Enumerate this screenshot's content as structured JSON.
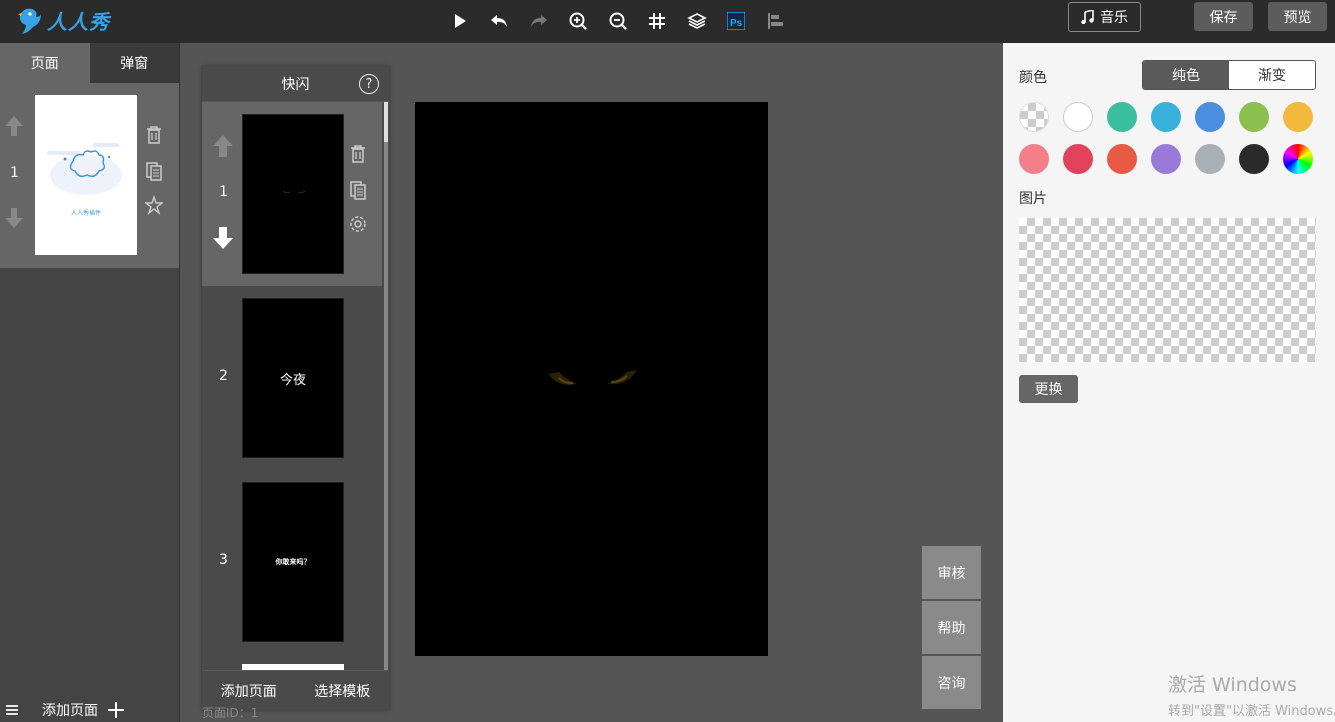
{
  "app": {
    "logo_text": "人人秀"
  },
  "toolbar": {
    "tools": [
      "play-icon",
      "undo-icon",
      "redo-icon",
      "zoom-in-icon",
      "zoom-out-icon",
      "grid-icon",
      "layers-icon",
      "ps-icon",
      "align-icon"
    ],
    "ps_label": "Ps",
    "music_label": "音乐",
    "save_label": "保存",
    "preview_label": "预览"
  },
  "left_panel": {
    "tabs": [
      "页面",
      "弹窗"
    ],
    "page": {
      "number": "1",
      "thumb_caption": "人人秀插件"
    },
    "add_page_label": "添加页面"
  },
  "frames_panel": {
    "title": "快闪",
    "help": "?",
    "frames": [
      {
        "number": "1",
        "text": ""
      },
      {
        "number": "2",
        "text": "今夜"
      },
      {
        "number": "3",
        "text": "你敢来吗？"
      }
    ],
    "add_page_label": "添加页面",
    "select_template_label": "选择模板"
  },
  "side_buttons": [
    "审核",
    "帮助",
    "咨询"
  ],
  "page_id_label": "页面ID：1",
  "right_panel": {
    "color_label": "颜色",
    "segments": [
      "纯色",
      "渐变"
    ],
    "swatches": [
      "transparent",
      "#ffffff",
      "#3abf9f",
      "#39b0dc",
      "#4a8ee0",
      "#8bc04e",
      "#f2b93d",
      "#f27f8a",
      "#e0435a",
      "#e85a43",
      "#9a7ad8",
      "#a8b0b8",
      "#2a2a2a",
      "rainbow"
    ],
    "image_label": "图片",
    "change_label": "更换"
  },
  "watermark": {
    "line1": "激活 Windows",
    "line2": "转到\"设置\"以激活 Windows。"
  }
}
